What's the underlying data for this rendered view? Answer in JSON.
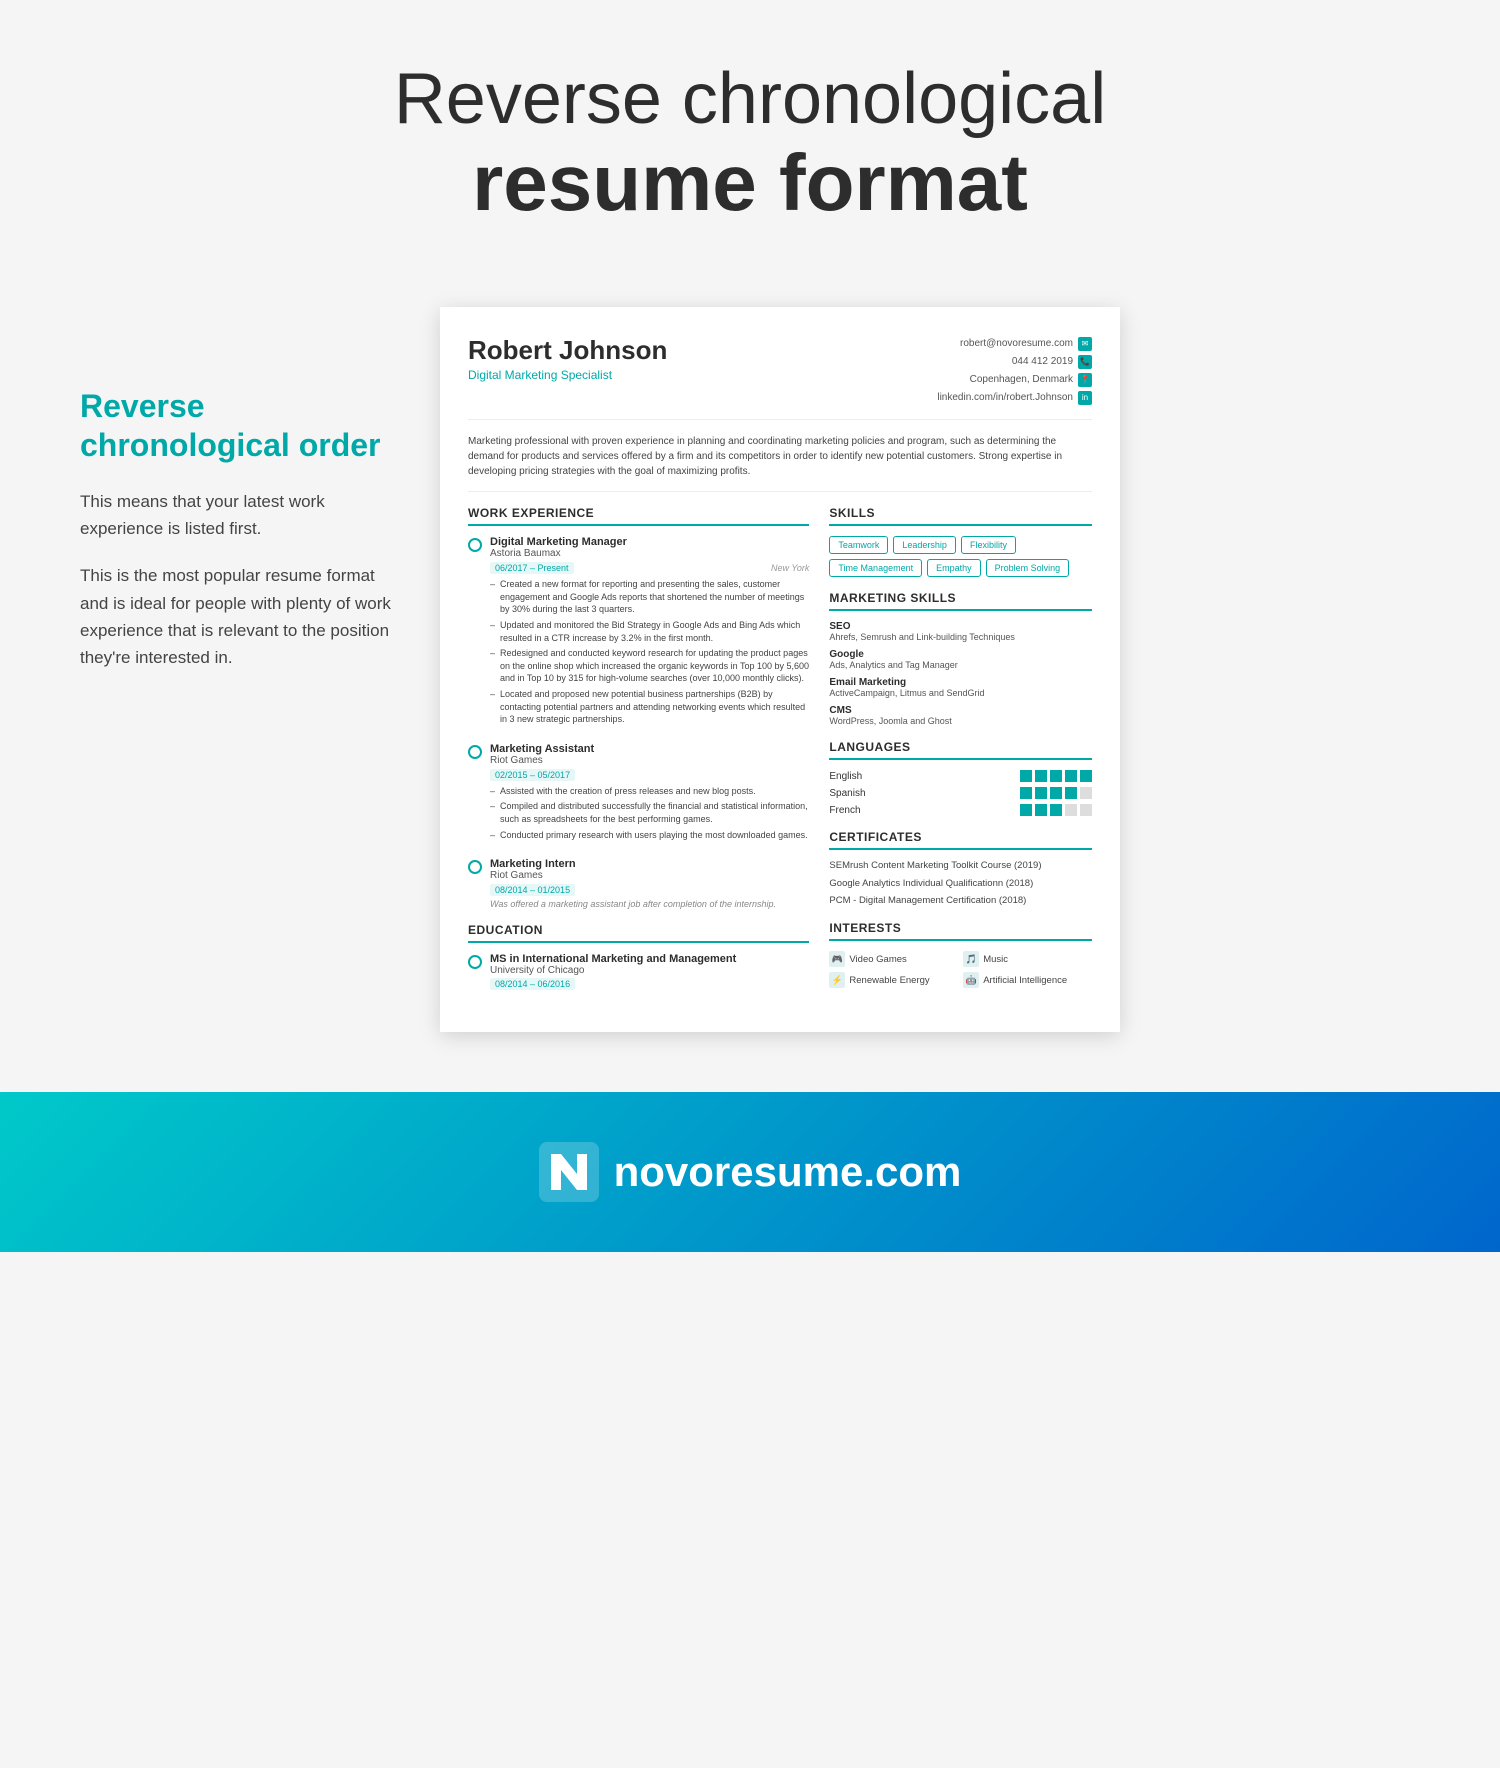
{
  "header": {
    "line1": "Reverse chronological",
    "line2": "resume format"
  },
  "left_panel": {
    "title": "Reverse chronological order",
    "desc1": "This means that your latest work experience is listed first.",
    "desc2": "This is the most popular resume format and is ideal for people with plenty of work experience that is relevant to the position they're interested in."
  },
  "resume": {
    "name": "Robert Johnson",
    "title": "Digital Marketing Specialist",
    "contact": {
      "email": "robert@novoresume.com",
      "phone": "044 412 2019",
      "location": "Copenhagen, Denmark",
      "linkedin": "linkedin.com/in/robert.Johnson"
    },
    "summary": "Marketing professional with proven experience in planning and coordinating marketing policies and program, such as determining the demand for products and services offered by a firm and its competitors in order to identify new potential customers. Strong expertise in developing pricing strategies with the goal of maximizing profits.",
    "work_experience_title": "WORK EXPERIENCE",
    "jobs": [
      {
        "title": "Digital Marketing Manager",
        "company": "Astoria Baumax",
        "dates": "06/2017 – Present",
        "location": "New York",
        "bullets": [
          "Created a new format for reporting and presenting the sales, customer engagement and Google Ads reports that shortened the number of meetings by 30% during the last 3 quarters.",
          "Updated and monitored the Bid Strategy in Google Ads and Bing Ads which resulted in a CTR increase by 3.2% in the first month.",
          "Redesigned and conducted keyword research for updating the product pages on the online shop which increased the organic keywords in Top 100 by 5,600 and in Top 10 by 315 for high-volume searches (over 10,000 monthly clicks).",
          "Located and proposed new potential business partnerships (B2B) by contacting potential partners and attending networking events which resulted in 3 new strategic partnerships."
        ]
      },
      {
        "title": "Marketing Assistant",
        "company": "Riot Games",
        "dates": "02/2015 – 05/2017",
        "location": "",
        "bullets": [
          "Assisted with the creation of press releases and new blog posts.",
          "Compiled and distributed successfully the financial and statistical information, such as spreadsheets for the best performing games.",
          "Conducted primary research with users playing the most downloaded games."
        ]
      },
      {
        "title": "Marketing Intern",
        "company": "Riot Games",
        "dates": "08/2014 – 01/2015",
        "location": "",
        "italic": "Was offered a marketing assistant job after completion of the internship.",
        "bullets": []
      }
    ],
    "education_title": "EDUCATION",
    "education": [
      {
        "degree": "MS in International Marketing and Management",
        "school": "University of Chicago",
        "dates": "08/2014 – 06/2016"
      }
    ],
    "skills_title": "SKILLS",
    "skills_tags": [
      "Teamwork",
      "Leadership",
      "Flexibility",
      "Time Management",
      "Empathy",
      "Problem Solving"
    ],
    "marketing_skills_title": "MARKETING SKILLS",
    "marketing_skills": [
      {
        "name": "SEO",
        "desc": "Ahrefs, Semrush and Link-building Techniques"
      },
      {
        "name": "Google",
        "desc": "Ads, Analytics and Tag Manager"
      },
      {
        "name": "Email Marketing",
        "desc": "ActiveCampaign, Litmus and SendGrid"
      },
      {
        "name": "CMS",
        "desc": "WordPress, Joomla and Ghost"
      }
    ],
    "languages_title": "LANGUAGES",
    "languages": [
      {
        "name": "English",
        "level": 5
      },
      {
        "name": "Spanish",
        "level": 4
      },
      {
        "name": "French",
        "level": 3
      }
    ],
    "certificates_title": "CERTIFICATES",
    "certificates": [
      "SEMrush Content Marketing Toolkit Course (2019)",
      "Google Analytics Individual Qualificationn (2018)",
      "PCM - Digital Management Certification (2018)"
    ],
    "interests_title": "INTERESTS",
    "interests": [
      {
        "name": "Video Games",
        "icon": "🎮"
      },
      {
        "name": "Music",
        "icon": "🎵"
      },
      {
        "name": "Renewable Energy",
        "icon": "⚡"
      },
      {
        "name": "Artificial Intelligence",
        "icon": "🤖"
      }
    ]
  },
  "footer": {
    "logo_text": "novoresume.com"
  }
}
